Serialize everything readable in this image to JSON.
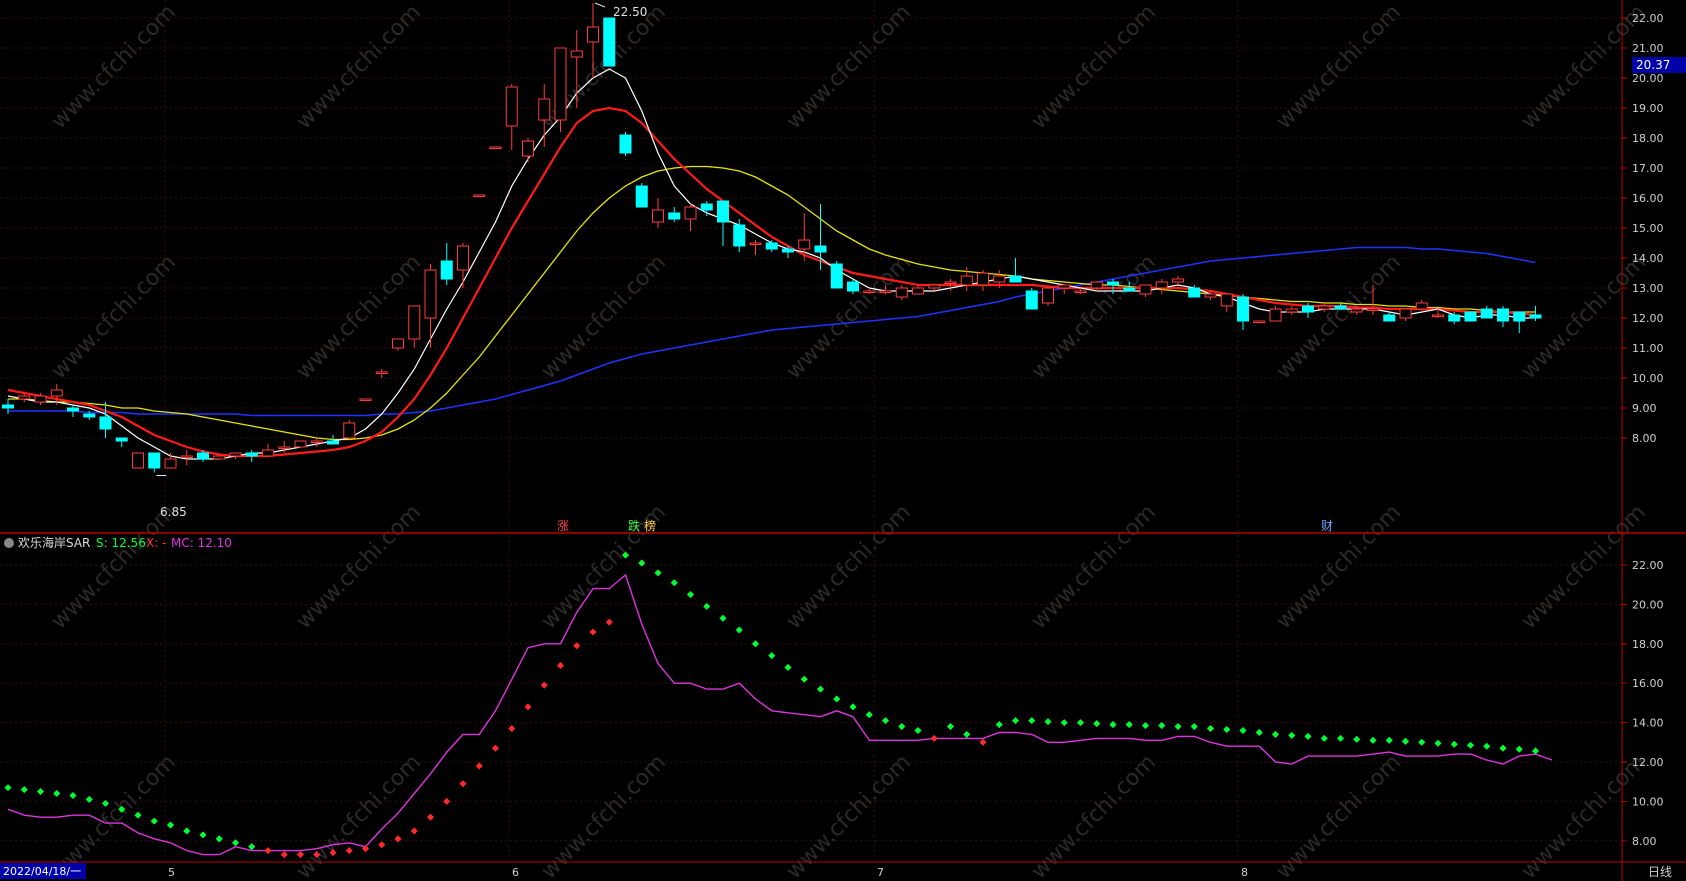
{
  "colors": {
    "background": "#000000",
    "grid": "#3a0c0c",
    "axis": "#b80000",
    "up": "#ff3b3b",
    "down": "#00ffff",
    "ma_white": "#ffffff",
    "ma_red": "#ff1a1a",
    "ma_yellow": "#e6e600",
    "ma_blue": "#1f33ff",
    "sar_green": "#00ff33",
    "sar_red": "#ff2a2a",
    "mc_magenta": "#e033e0",
    "text_grey": "#cfcfcf",
    "current_price_bg": "#0000a8",
    "date_bg": "#0000a8"
  },
  "main": {
    "y_ticks": [
      "22.00",
      "21.00",
      "20.00",
      "19.00",
      "18.00",
      "17.00",
      "16.00",
      "15.00",
      "14.00",
      "13.00",
      "12.00",
      "11.00",
      "10.00",
      "9.00",
      "8.00"
    ],
    "current_price": "20.37",
    "high_label": "22.50",
    "low_label": "6.85",
    "events": [
      {
        "text": "涨",
        "color": "#ff4040"
      },
      {
        "text": "跌",
        "color": "#40ff40"
      },
      {
        "text": "榜",
        "color": "#ffcc40"
      },
      {
        "text": "财",
        "color": "#6fa8ff"
      }
    ]
  },
  "indicator": {
    "name": "欢乐海岸SAR",
    "s_label": "S: 12.56",
    "x_label": "X: -",
    "mc_label": "MC: 12.10",
    "y_ticks": [
      "22.00",
      "20.00",
      "18.00",
      "16.00",
      "14.00",
      "12.00",
      "10.00",
      "8.00"
    ]
  },
  "x_axis": {
    "start_date": "2022/04/18/一",
    "months": [
      "5",
      "6",
      "7",
      "8"
    ],
    "period": "日线"
  },
  "watermark": "www.cfchi.com",
  "chart_data": {
    "type": "candlestick",
    "ylim_main": [
      7.0,
      22.6
    ],
    "ylim_indicator": [
      7.0,
      23.0
    ],
    "candles": [
      [
        9.1,
        8.8,
        9.3,
        9.0
      ],
      [
        9.3,
        9.2,
        9.5,
        9.4
      ],
      [
        9.2,
        9.1,
        9.5,
        9.4
      ],
      [
        9.4,
        9.1,
        9.8,
        9.6
      ],
      [
        9.0,
        8.7,
        9.1,
        8.9
      ],
      [
        8.8,
        8.6,
        8.9,
        8.7
      ],
      [
        8.7,
        8.0,
        9.2,
        8.3
      ],
      [
        8.0,
        7.7,
        8.0,
        7.9
      ],
      [
        7.0,
        7.0,
        7.5,
        7.5
      ],
      [
        7.5,
        6.85,
        7.5,
        7.0
      ],
      [
        7.0,
        7.0,
        7.5,
        7.3
      ],
      [
        7.4,
        7.1,
        7.6,
        7.4
      ],
      [
        7.5,
        7.2,
        7.6,
        7.3
      ],
      [
        7.3,
        7.3,
        7.4,
        7.4
      ],
      [
        7.4,
        7.3,
        7.5,
        7.5
      ],
      [
        7.5,
        7.2,
        7.6,
        7.4
      ],
      [
        7.4,
        7.4,
        7.8,
        7.6
      ],
      [
        7.7,
        7.5,
        7.9,
        7.7
      ],
      [
        7.7,
        7.7,
        7.9,
        7.9
      ],
      [
        7.9,
        7.7,
        8.0,
        7.9
      ],
      [
        7.9,
        7.8,
        8.1,
        7.8
      ],
      [
        8.0,
        8.0,
        8.6,
        8.5
      ],
      [
        9.3,
        9.3,
        9.3,
        9.3
      ],
      [
        10.2,
        10.0,
        10.3,
        10.2
      ],
      [
        11.0,
        10.9,
        11.3,
        11.3
      ],
      [
        11.3,
        11.0,
        12.4,
        12.4
      ],
      [
        12.0,
        11.0,
        13.8,
        13.6
      ],
      [
        13.9,
        13.1,
        14.5,
        13.3
      ],
      [
        13.6,
        13.0,
        14.5,
        14.4
      ],
      [
        16.1,
        16.1,
        16.1,
        16.1
      ],
      [
        17.7,
        17.7,
        17.7,
        17.7
      ],
      [
        18.4,
        17.6,
        19.8,
        19.7
      ],
      [
        17.4,
        17.2,
        18.0,
        17.9
      ],
      [
        18.6,
        17.7,
        19.8,
        19.3
      ],
      [
        18.6,
        18.2,
        21.0,
        21.0
      ],
      [
        20.7,
        19.0,
        21.6,
        20.9
      ],
      [
        21.2,
        20.0,
        22.5,
        21.7
      ],
      [
        22.0,
        20.4,
        22.0,
        20.4
      ],
      [
        18.1,
        17.4,
        18.2,
        17.5
      ],
      [
        16.4,
        15.7,
        16.5,
        15.7
      ],
      [
        15.2,
        15.0,
        16.0,
        15.6
      ],
      [
        15.5,
        15.2,
        15.7,
        15.3
      ],
      [
        15.3,
        14.9,
        15.8,
        15.7
      ],
      [
        15.8,
        15.4,
        15.9,
        15.6
      ],
      [
        15.9,
        14.4,
        15.9,
        15.2
      ],
      [
        15.1,
        14.2,
        15.3,
        14.4
      ],
      [
        14.5,
        14.1,
        14.6,
        14.5
      ],
      [
        14.5,
        14.2,
        14.6,
        14.3
      ],
      [
        14.3,
        14.0,
        14.4,
        14.2
      ],
      [
        14.3,
        13.9,
        15.5,
        14.6
      ],
      [
        14.4,
        13.6,
        15.8,
        14.2
      ],
      [
        13.8,
        13.0,
        13.9,
        13.0
      ],
      [
        13.2,
        12.8,
        13.3,
        12.9
      ],
      [
        12.9,
        12.8,
        13.0,
        12.9
      ],
      [
        12.9,
        12.8,
        13.1,
        12.9
      ],
      [
        12.7,
        12.6,
        13.1,
        13.0
      ],
      [
        12.8,
        12.8,
        13.1,
        13.0
      ],
      [
        13.0,
        12.9,
        13.1,
        13.1
      ],
      [
        13.2,
        12.9,
        13.3,
        13.2
      ],
      [
        13.1,
        12.9,
        13.7,
        13.4
      ],
      [
        13.1,
        12.9,
        13.6,
        13.5
      ],
      [
        13.2,
        13.0,
        13.6,
        13.4
      ],
      [
        13.4,
        13.2,
        14.0,
        13.2
      ],
      [
        12.9,
        12.3,
        13.0,
        12.3
      ],
      [
        12.5,
        12.4,
        13.0,
        13.0
      ],
      [
        13.0,
        12.8,
        13.1,
        13.1
      ],
      [
        12.9,
        12.8,
        13.0,
        12.9
      ],
      [
        13.0,
        12.9,
        13.2,
        13.2
      ],
      [
        13.2,
        12.8,
        13.3,
        13.1
      ],
      [
        13.0,
        12.9,
        13.2,
        12.9
      ],
      [
        12.8,
        12.7,
        13.1,
        13.1
      ],
      [
        13.0,
        12.8,
        13.3,
        13.2
      ],
      [
        13.2,
        13.1,
        13.4,
        13.3
      ],
      [
        13.0,
        12.7,
        13.1,
        12.7
      ],
      [
        12.7,
        12.6,
        12.9,
        12.8
      ],
      [
        12.4,
        12.2,
        12.8,
        12.8
      ],
      [
        12.7,
        11.6,
        12.8,
        11.9
      ],
      [
        11.9,
        11.9,
        11.9,
        11.9
      ],
      [
        11.9,
        11.9,
        12.4,
        12.3
      ],
      [
        12.2,
        12.1,
        12.4,
        12.3
      ],
      [
        12.4,
        12.0,
        12.5,
        12.2
      ],
      [
        12.3,
        12.2,
        12.5,
        12.4
      ],
      [
        12.4,
        12.3,
        12.5,
        12.3
      ],
      [
        12.2,
        12.1,
        12.4,
        12.3
      ],
      [
        12.3,
        12.1,
        13.1,
        12.3
      ],
      [
        12.1,
        11.9,
        12.2,
        11.9
      ],
      [
        12.0,
        11.9,
        12.3,
        12.3
      ],
      [
        12.3,
        12.2,
        12.6,
        12.5
      ],
      [
        12.1,
        12.0,
        12.3,
        12.1
      ],
      [
        12.1,
        11.8,
        12.2,
        11.9
      ],
      [
        12.2,
        11.9,
        12.2,
        11.9
      ],
      [
        12.3,
        12.0,
        12.4,
        12.0
      ],
      [
        12.3,
        11.7,
        12.4,
        11.9
      ],
      [
        12.2,
        11.5,
        12.2,
        11.9
      ],
      [
        12.1,
        11.9,
        12.4,
        12.0
      ]
    ],
    "ma_white": [
      9.4,
      9.3,
      9.2,
      9.2,
      9.1,
      9.0,
      8.8,
      8.4,
      8.0,
      7.7,
      7.4,
      7.3,
      7.3,
      7.3,
      7.4,
      7.5,
      7.5,
      7.6,
      7.7,
      7.8,
      7.9,
      8.0,
      8.3,
      8.8,
      9.5,
      10.3,
      11.3,
      12.3,
      13.2,
      14.2,
      15.2,
      16.4,
      17.3,
      18.1,
      18.7,
      19.5,
      20.0,
      20.3,
      20.0,
      18.9,
      17.5,
      16.4,
      15.8,
      15.5,
      15.3,
      15.1,
      14.8,
      14.5,
      14.3,
      14.2,
      14.0,
      13.6,
      13.3,
      13.0,
      12.9,
      12.9,
      12.9,
      12.9,
      13.0,
      13.1,
      13.2,
      13.3,
      13.4,
      13.3,
      13.2,
      13.1,
      13.0,
      12.9,
      12.9,
      12.9,
      12.9,
      13.0,
      13.1,
      13.0,
      12.8,
      12.7,
      12.5,
      12.3,
      12.2,
      12.2,
      12.2,
      12.3,
      12.3,
      12.3,
      12.3,
      12.2,
      12.1,
      12.2,
      12.3,
      12.1,
      12.0,
      12.1,
      12.1,
      12.0,
      12.0
    ],
    "ma_red": [
      9.6,
      9.5,
      9.4,
      9.3,
      9.2,
      9.1,
      8.9,
      8.7,
      8.4,
      8.1,
      7.9,
      7.7,
      7.55,
      7.45,
      7.4,
      7.4,
      7.4,
      7.45,
      7.5,
      7.55,
      7.6,
      7.7,
      7.9,
      8.2,
      8.7,
      9.3,
      10.1,
      11.0,
      12.0,
      13.0,
      14.0,
      15.0,
      15.9,
      16.8,
      17.7,
      18.5,
      18.9,
      19.0,
      18.9,
      18.5,
      17.9,
      17.3,
      16.8,
      16.3,
      15.9,
      15.5,
      15.1,
      14.7,
      14.4,
      14.1,
      13.9,
      13.7,
      13.5,
      13.4,
      13.3,
      13.2,
      13.1,
      13.1,
      13.1,
      13.1,
      13.1,
      13.1,
      13.1,
      13.1,
      13.05,
      13.0,
      13.0,
      13.0,
      13.0,
      13.0,
      13.0,
      13.0,
      13.0,
      12.95,
      12.9,
      12.8,
      12.7,
      12.6,
      12.5,
      12.45,
      12.4,
      12.4,
      12.4,
      12.35,
      12.35,
      12.3,
      12.3,
      12.3,
      12.3,
      12.25,
      12.2,
      12.2,
      12.2,
      12.15,
      12.1
    ],
    "ma_yellow": [
      9.3,
      9.3,
      9.25,
      9.2,
      9.2,
      9.15,
      9.1,
      9.0,
      9.0,
      8.9,
      8.85,
      8.8,
      8.7,
      8.6,
      8.5,
      8.4,
      8.3,
      8.2,
      8.1,
      8.0,
      7.95,
      7.95,
      8.0,
      8.1,
      8.3,
      8.6,
      9.0,
      9.5,
      10.1,
      10.7,
      11.4,
      12.1,
      12.8,
      13.5,
      14.2,
      14.9,
      15.5,
      16.0,
      16.4,
      16.7,
      16.9,
      17.0,
      17.05,
      17.05,
      17.0,
      16.9,
      16.7,
      16.4,
      16.1,
      15.7,
      15.3,
      14.9,
      14.6,
      14.3,
      14.1,
      13.95,
      13.8,
      13.7,
      13.6,
      13.55,
      13.5,
      13.45,
      13.4,
      13.3,
      13.25,
      13.2,
      13.15,
      13.1,
      13.1,
      13.05,
      13.0,
      12.95,
      12.9,
      12.85,
      12.8,
      12.75,
      12.7,
      12.65,
      12.6,
      12.55,
      12.55,
      12.5,
      12.5,
      12.45,
      12.45,
      12.4,
      12.4,
      12.35,
      12.35,
      12.3,
      12.3,
      12.25,
      12.2,
      12.2,
      12.2
    ],
    "ma_blue": [
      8.9,
      8.9,
      8.9,
      8.9,
      8.9,
      8.85,
      8.85,
      8.85,
      8.8,
      8.8,
      8.8,
      8.8,
      8.8,
      8.8,
      8.8,
      8.75,
      8.75,
      8.75,
      8.75,
      8.75,
      8.75,
      8.75,
      8.75,
      8.8,
      8.8,
      8.85,
      8.9,
      9.0,
      9.1,
      9.2,
      9.3,
      9.45,
      9.6,
      9.75,
      9.9,
      10.1,
      10.3,
      10.5,
      10.65,
      10.8,
      10.9,
      11.0,
      11.1,
      11.2,
      11.3,
      11.4,
      11.5,
      11.6,
      11.65,
      11.7,
      11.75,
      11.8,
      11.85,
      11.9,
      11.95,
      12.0,
      12.05,
      12.15,
      12.25,
      12.35,
      12.45,
      12.55,
      12.7,
      12.8,
      12.9,
      13.0,
      13.1,
      13.2,
      13.3,
      13.4,
      13.5,
      13.6,
      13.7,
      13.8,
      13.9,
      13.95,
      14.0,
      14.05,
      14.1,
      14.15,
      14.2,
      14.25,
      14.3,
      14.35,
      14.35,
      14.35,
      14.35,
      14.3,
      14.3,
      14.25,
      14.2,
      14.15,
      14.05,
      13.95,
      13.85
    ],
    "sar": [
      10.7,
      10.6,
      10.5,
      10.4,
      10.3,
      10.1,
      9.9,
      9.6,
      9.3,
      9.0,
      8.8,
      8.5,
      8.3,
      8.1,
      7.9,
      7.7,
      7.5,
      7.3,
      7.3,
      7.3,
      7.4,
      7.5,
      7.6,
      7.8,
      8.1,
      8.5,
      9.2,
      10.0,
      10.9,
      11.8,
      12.7,
      13.7,
      14.8,
      15.9,
      16.9,
      17.9,
      18.6,
      19.1,
      22.5,
      22.1,
      21.6,
      21.1,
      20.5,
      19.9,
      19.3,
      18.7,
      18.0,
      17.4,
      16.8,
      16.2,
      15.7,
      15.2,
      14.8,
      14.4,
      14.1,
      13.8,
      13.6,
      13.2,
      13.8,
      13.4,
      13.0,
      13.9,
      14.1,
      14.1,
      14.05,
      14.0,
      14.0,
      13.95,
      13.9,
      13.9,
      13.85,
      13.85,
      13.8,
      13.8,
      13.7,
      13.65,
      13.6,
      13.5,
      13.4,
      13.35,
      13.3,
      13.2,
      13.2,
      13.15,
      13.1,
      13.1,
      13.05,
      13.0,
      12.95,
      12.9,
      12.85,
      12.8,
      12.7,
      12.65,
      12.56
    ],
    "sar_red_index": [
      16,
      17,
      18,
      19,
      20,
      21,
      22,
      23,
      24,
      25,
      26,
      27,
      28,
      29,
      30,
      31,
      32,
      33,
      34,
      35,
      36,
      37,
      57,
      60
    ],
    "mc": [
      9.6,
      9.3,
      9.2,
      9.2,
      9.3,
      9.3,
      8.9,
      8.9,
      8.4,
      8.1,
      7.9,
      7.5,
      7.3,
      7.3,
      7.7,
      7.5,
      7.5,
      7.5,
      7.5,
      7.6,
      7.8,
      7.9,
      7.7,
      8.6,
      9.4,
      10.4,
      11.4,
      12.5,
      13.4,
      13.4,
      14.6,
      16.2,
      17.8,
      18.0,
      18.0,
      19.6,
      20.8,
      20.8,
      21.5,
      19.0,
      17.0,
      16.0,
      16.0,
      15.7,
      15.7,
      16.0,
      15.2,
      14.6,
      14.5,
      14.4,
      14.3,
      14.6,
      14.3,
      13.1,
      13.1,
      13.1,
      13.1,
      13.2,
      13.2,
      13.2,
      13.2,
      13.5,
      13.5,
      13.4,
      13.0,
      13.0,
      13.1,
      13.2,
      13.2,
      13.2,
      13.1,
      13.1,
      13.3,
      13.3,
      13.0,
      12.8,
      12.8,
      12.8,
      12.0,
      11.9,
      12.3,
      12.3,
      12.3,
      12.3,
      12.4,
      12.5,
      12.3,
      12.3,
      12.3,
      12.4,
      12.4,
      12.1,
      11.9,
      12.3,
      12.4,
      12.1
    ]
  }
}
